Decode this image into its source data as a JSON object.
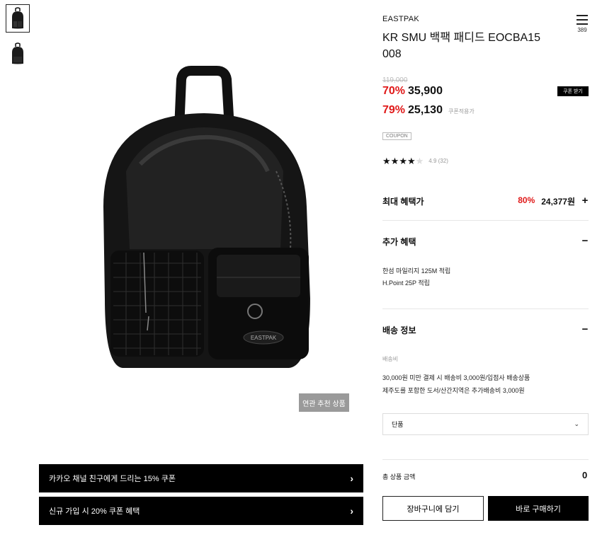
{
  "thumbnails": [
    "backpack-thumbnail-1",
    "backpack-thumbnail-2"
  ],
  "related_button": "연관 추천 상품",
  "banners": [
    {
      "label": "카카오 채널 친구에게 드리는 15% 쿠폰",
      "icon": "chevron-right-icon"
    },
    {
      "label": "신규 가입 시 20% 쿠폰 혜택",
      "icon": "chevron-right-icon"
    }
  ],
  "product": {
    "brand": "EASTPAK",
    "title": "KR SMU 백팩 패디드 EOCBA15 008",
    "wish_count": "389",
    "original_price": "119,000",
    "sale_pct": "70%",
    "sale_price": "35,900",
    "coupon_pct": "79%",
    "coupon_price": "25,130",
    "coupon_note": "쿠폰적용가",
    "coupon_get_label": "쿠폰 받기",
    "coupon_tag": "COUPON",
    "rating": {
      "stars": 4,
      "max": 5,
      "score": "4.9",
      "count": "(32)"
    }
  },
  "max_benefit": {
    "title": "최대 혜택가",
    "pct": "80%",
    "price": "24,377원",
    "toggle": "+"
  },
  "extra_benefit": {
    "title": "추가 혜택",
    "toggle": "−",
    "lines": [
      "한섬 마일리지 125M 적립",
      "H.Point 25P 적립"
    ]
  },
  "shipping": {
    "title": "배송 정보",
    "toggle": "−",
    "fee_label": "배송비",
    "lines": [
      "30,000원 미만 결제 시 배송비 3,000원/입점사 배송상품",
      "제주도를 포함한 도서/산간지역은 추가배송비 3,000원"
    ]
  },
  "option_select": {
    "value": "단품",
    "icon": "chevron-down-icon"
  },
  "total": {
    "label": "총 상품 금액",
    "value": "0"
  },
  "actions": {
    "cart": "장바구니에 담기",
    "buy": "바로 구매하기"
  },
  "colors": {
    "accent_red": "#e01919",
    "black": "#000000",
    "gray_button": "#9a9a9a"
  }
}
